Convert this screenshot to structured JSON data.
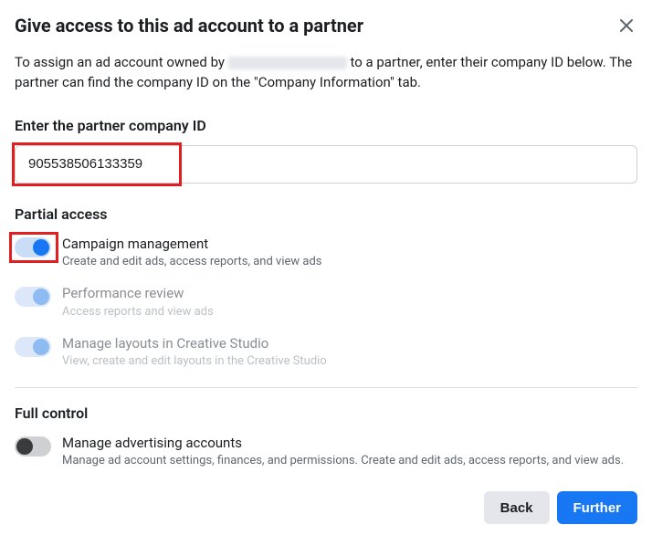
{
  "dialog": {
    "title": "Give access to this ad account to a partner",
    "description_before": "To assign an ad account owned by ",
    "description_after": " to a partner, enter their company ID below. The partner can find the company ID on the \"Company Information\" tab."
  },
  "field": {
    "label": "Enter the partner company ID",
    "value": "905538506133359"
  },
  "partial": {
    "heading": "Partial access",
    "items": [
      {
        "title": "Campaign management",
        "desc": "Create and edit ads, access reports, and view ads"
      },
      {
        "title": "Performance review",
        "desc": "Access reports and view ads"
      },
      {
        "title": "Manage layouts in Creative Studio",
        "desc": "View, create and edit layouts in the Creative Studio"
      }
    ]
  },
  "full": {
    "heading": "Full control",
    "item": {
      "title": "Manage advertising accounts",
      "desc": "Manage ad account settings, finances, and permissions. Create and edit ads, access reports, and view ads."
    }
  },
  "footer": {
    "back": "Back",
    "further": "Further"
  }
}
